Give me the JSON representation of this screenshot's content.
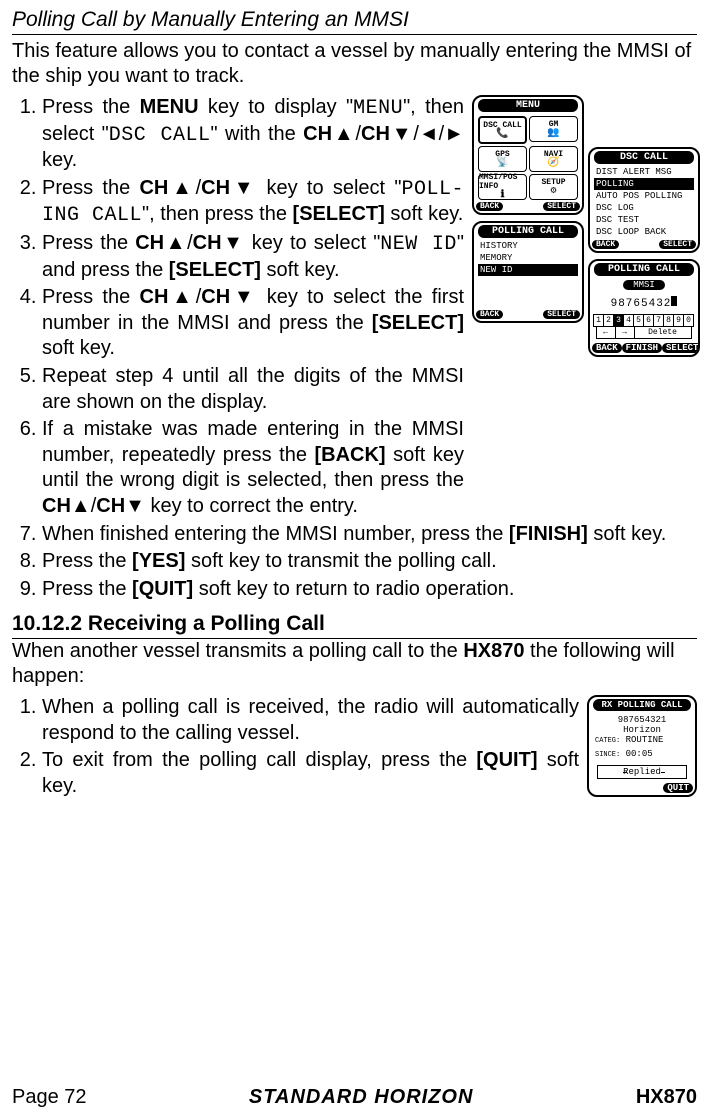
{
  "section_title": "Polling Call by Manually Entering an MMSI",
  "intro": "This feature allows you to contact a vessel by manually entering the MMSI of the ship you want to track.",
  "steps_a": [
    "Press the <b>MENU</b> key to display \"<c>MENU</c>\", then select \"<c>DSC CALL</c>\" with the <b>CH▲</b>/<b>CH▼</b>/◄/► key.",
    "Press the <b>CH▲</b>/<b>CH▼</b> key to select \"<c>POLL-ING CALL</c>\", then press the <b>[SELECT]</b> soft key.",
    "Press the <b>CH▲</b>/<b>CH▼</b> key to select \"<c>NEW ID</c>\" and press the <b>[SELECT]</b> soft key.",
    "Press the <b>CH▲</b>/<b>CH▼</b> key to select the first number in the MMSI and press the <b>[SELECT]</b> soft key.",
    "Repeat step 4 until all the digits of the MMSI are shown on the display.",
    "If a mistake was made entering in the MMSI number, repeatedly press the <b>[BACK]</b> soft key until the wrong digit is selected, then press the <b>CH▲</b>/<b>CH▼</b> key to correct the entry."
  ],
  "steps_b": [
    "When finished entering the MMSI number, press the <b>[FINISH]</b> soft key.",
    "Press the <b>[YES]</b> soft key to transmit the polling call.",
    "Press the <b>[QUIT]</b> soft key to return to radio operation."
  ],
  "subsection": "10.12.2  Receiving a Polling Call",
  "subintro": "When another vessel transmits a polling call to the <b>HX870</b> the following will happen:",
  "steps_c": [
    "When a polling call is received, the radio will automatically respond to the calling vessel.",
    "To exit from the polling call display, press the <b>[QUIT]</b> soft key."
  ],
  "footer": {
    "page": "Page 72",
    "brand": "STANDARD HORIZON",
    "model": "HX870"
  },
  "menu_screen": {
    "title": "MENU",
    "cells": [
      "DSC CALL",
      "GM",
      "GPS",
      "NAVI",
      "MMSI/POS INFO",
      "SETUP"
    ],
    "back": "BACK",
    "select": "SELECT"
  },
  "dsc_screen": {
    "title": "DSC CALL",
    "items": [
      "DIST ALERT MSG",
      "POLLING",
      "AUTO POS POLLING",
      "DSC LOG",
      "DSC TEST",
      "DSC LOOP BACK"
    ],
    "selected_index": 1,
    "back": "BACK",
    "select": "SELECT"
  },
  "polling_screen": {
    "title": "POLLING CALL",
    "items": [
      "HISTORY",
      "MEMORY",
      "NEW ID"
    ],
    "selected_index": 2,
    "back": "BACK",
    "select": "SELECT"
  },
  "mmsi_screen": {
    "title": "POLLING CALL",
    "subtitle": "MMSI",
    "value": "98765432",
    "digits": [
      "1",
      "2",
      "3",
      "4",
      "5",
      "6",
      "7",
      "8",
      "9",
      "0"
    ],
    "selected_digit_index": 2,
    "arrows": [
      "←",
      "→"
    ],
    "delete": "Delete",
    "back": "BACK",
    "finish": "FINISH",
    "select": "SELECT"
  },
  "rx_screen": {
    "title": "RX POLLING CALL",
    "mmsi": "987654321",
    "name": "Horizon",
    "categ_label": "CATEG:",
    "categ": "ROUTINE",
    "since_label": "SINCE:",
    "since": "00:05",
    "replied": "Replied",
    "quit": "QUIT"
  }
}
